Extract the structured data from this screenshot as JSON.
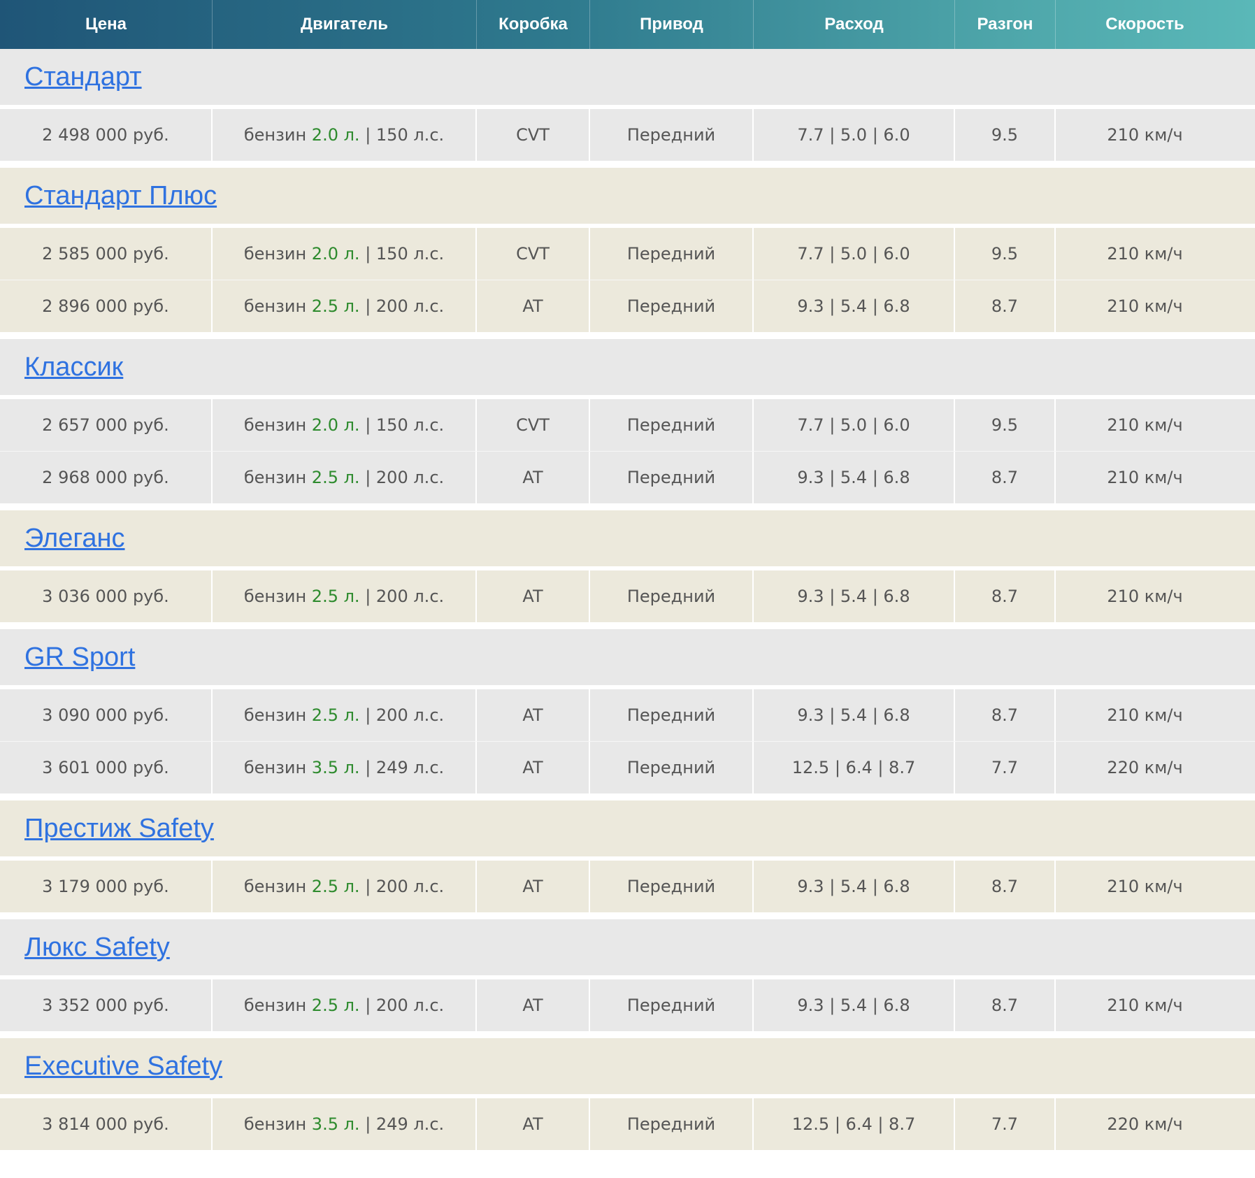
{
  "columns": [
    "Цена",
    "Двигатель",
    "Коробка",
    "Привод",
    "Расход",
    "Разгон",
    "Скорость"
  ],
  "groups": [
    {
      "name": "Стандарт",
      "bg": "gray",
      "rows": [
        {
          "price": "2 498 000 руб.",
          "fuel": "бензин",
          "volume": "2.0 л.",
          "power": "150 л.с.",
          "gearbox": "CVT",
          "drive": "Передний",
          "consumption": "7.7 | 5.0 | 6.0",
          "accel": "9.5",
          "speed": "210 км/ч"
        }
      ]
    },
    {
      "name": "Стандарт Плюс",
      "bg": "beige",
      "rows": [
        {
          "price": "2 585 000 руб.",
          "fuel": "бензин",
          "volume": "2.0 л.",
          "power": "150 л.с.",
          "gearbox": "CVT",
          "drive": "Передний",
          "consumption": "7.7 | 5.0 | 6.0",
          "accel": "9.5",
          "speed": "210 км/ч"
        },
        {
          "price": "2 896 000 руб.",
          "fuel": "бензин",
          "volume": "2.5 л.",
          "power": "200 л.с.",
          "gearbox": "AT",
          "drive": "Передний",
          "consumption": "9.3 | 5.4 | 6.8",
          "accel": "8.7",
          "speed": "210 км/ч"
        }
      ]
    },
    {
      "name": "Классик",
      "bg": "gray",
      "rows": [
        {
          "price": "2 657 000 руб.",
          "fuel": "бензин",
          "volume": "2.0 л.",
          "power": "150 л.с.",
          "gearbox": "CVT",
          "drive": "Передний",
          "consumption": "7.7 | 5.0 | 6.0",
          "accel": "9.5",
          "speed": "210 км/ч"
        },
        {
          "price": "2 968 000 руб.",
          "fuel": "бензин",
          "volume": "2.5 л.",
          "power": "200 л.с.",
          "gearbox": "AT",
          "drive": "Передний",
          "consumption": "9.3 | 5.4 | 6.8",
          "accel": "8.7",
          "speed": "210 км/ч"
        }
      ]
    },
    {
      "name": "Элеганс",
      "bg": "beige",
      "rows": [
        {
          "price": "3 036 000 руб.",
          "fuel": "бензин",
          "volume": "2.5 л.",
          "power": "200 л.с.",
          "gearbox": "AT",
          "drive": "Передний",
          "consumption": "9.3 | 5.4 | 6.8",
          "accel": "8.7",
          "speed": "210 км/ч"
        }
      ]
    },
    {
      "name": "GR Sport",
      "bg": "gray",
      "rows": [
        {
          "price": "3 090 000 руб.",
          "fuel": "бензин",
          "volume": "2.5 л.",
          "power": "200 л.с.",
          "gearbox": "AT",
          "drive": "Передний",
          "consumption": "9.3 | 5.4 | 6.8",
          "accel": "8.7",
          "speed": "210 км/ч"
        },
        {
          "price": "3 601 000 руб.",
          "fuel": "бензин",
          "volume": "3.5 л.",
          "power": "249 л.с.",
          "gearbox": "AT",
          "drive": "Передний",
          "consumption": "12.5 | 6.4 | 8.7",
          "accel": "7.7",
          "speed": "220 км/ч"
        }
      ]
    },
    {
      "name": "Престиж Safety",
      "bg": "beige",
      "rows": [
        {
          "price": "3 179 000 руб.",
          "fuel": "бензин",
          "volume": "2.5 л.",
          "power": "200 л.с.",
          "gearbox": "AT",
          "drive": "Передний",
          "consumption": "9.3 | 5.4 | 6.8",
          "accel": "8.7",
          "speed": "210 км/ч"
        }
      ]
    },
    {
      "name": "Люкс Safety",
      "bg": "gray",
      "rows": [
        {
          "price": "3 352 000 руб.",
          "fuel": "бензин",
          "volume": "2.5 л.",
          "power": "200 л.с.",
          "gearbox": "AT",
          "drive": "Передний",
          "consumption": "9.3 | 5.4 | 6.8",
          "accel": "8.7",
          "speed": "210 км/ч"
        }
      ]
    },
    {
      "name": "Executive Safety",
      "bg": "beige",
      "rows": [
        {
          "price": "3 814 000 руб.",
          "fuel": "бензин",
          "volume": "3.5 л.",
          "power": "249 л.с.",
          "gearbox": "AT",
          "drive": "Передний",
          "consumption": "12.5 | 6.4 | 8.7",
          "accel": "7.7",
          "speed": "220 км/ч"
        }
      ]
    }
  ],
  "colors": {
    "header_start": "#1f5577",
    "header_end": "#5ab8b8",
    "link": "#2f72e0",
    "volume": "#2e8b2e",
    "gray_bg": "#e8e8e8",
    "beige_bg": "#ece9dc"
  }
}
